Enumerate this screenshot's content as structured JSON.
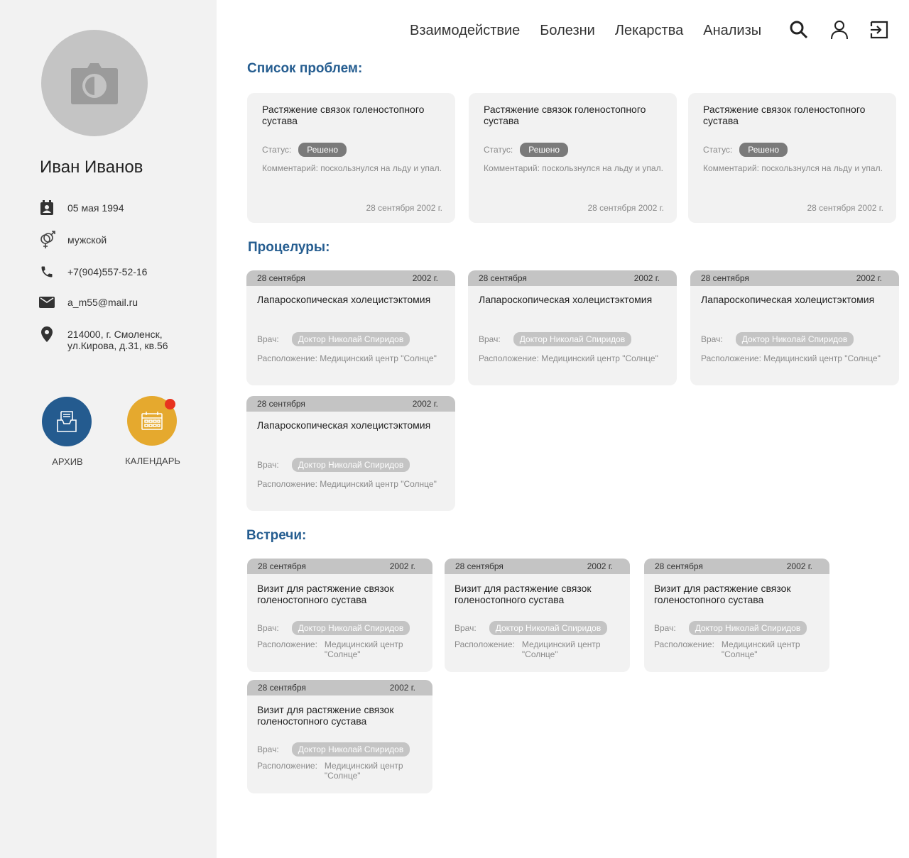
{
  "patient": {
    "name": "Иван Иванов",
    "birthdate": "05 мая 1994",
    "gender": "мужской",
    "phone": "+7(904)557-52-16",
    "email": "a_m55@mail.ru",
    "address_line1": "214000, г. Смоленск,",
    "address_line2": "ул.Кирова, д.31, кв.56"
  },
  "sidebar": {
    "archive_label": "АРХИВ",
    "calendar_label": "КАЛЕНДАРЬ",
    "archive_color": "#245b8f",
    "calendar_color": "#e5a92e"
  },
  "nav": {
    "items": [
      "Взаимодействие",
      "Болезни",
      "Лекарства",
      "Анализы"
    ]
  },
  "sections": {
    "problems_title": "Список проблем:",
    "procedures_title": "Процелуры:",
    "meetings_title": "Встречи:"
  },
  "labels": {
    "status": "Статус:",
    "doctor": "Врач:",
    "location": "Расположение:"
  },
  "problems": [
    {
      "title": "Растяжение связок голеностопного сустава",
      "status": "Решено",
      "comment": "Комментарий: поскользнулся на льду и упал.",
      "date": "28 сентября 2002 г."
    },
    {
      "title": "Растяжение связок голеностопного сустава",
      "status": "Решено",
      "comment": "Комментарий: поскользнулся на льду и упал.",
      "date": "28 сентября 2002 г."
    },
    {
      "title": "Растяжение связок голеностопного сустава",
      "status": "Решено",
      "comment": "Комментарий: поскользнулся на льду и упал.",
      "date": "28 сентября 2002 г."
    }
  ],
  "procedures": [
    {
      "day": "28 сентября",
      "year": "2002 г.",
      "title": "Лапароскопическая холецистэктомия",
      "doctor": "Доктор Николай Спиридов",
      "location": "Расположение: Медицинский центр \"Солнце\""
    },
    {
      "day": "28 сентября",
      "year": "2002 г.",
      "title": "Лапароскопическая холецистэктомия",
      "doctor": "Доктор Николай Спиридов",
      "location": "Расположение: Медицинский центр \"Солнце\""
    },
    {
      "day": "28 сентября",
      "year": "2002 г.",
      "title": "Лапароскопическая холецистэктомия",
      "doctor": "Доктор Николай Спиридов",
      "location": "Расположение: Медицинский центр \"Солнце\""
    },
    {
      "day": "28 сентября",
      "year": "2002 г.",
      "title": "Лапароскопическая холецистэктомия",
      "doctor": "Доктор Николай Спиридов",
      "location": "Расположение: Медицинский центр \"Солнце\""
    }
  ],
  "meetings": [
    {
      "day": "28 сентября",
      "year": "2002 г.",
      "title": "Визит для растяжение связок голеностопного сустава",
      "doctor": "Доктор Николай Спиридов",
      "location_line1": "Медицинский центр",
      "location_line2": "\"Солнце\""
    },
    {
      "day": "28 сентября",
      "year": "2002 г.",
      "title": "Визит для растяжение связок голеностопного сустава",
      "doctor": "Доктор Николай Спиридов",
      "location_line1": "Медицинский центр",
      "location_line2": "\"Солнце\""
    },
    {
      "day": "28 сентября",
      "year": "2002 г.",
      "title": "Визит для растяжение связок голеностопного сустава",
      "doctor": "Доктор Николай Спиридов",
      "location_line1": "Медицинский центр",
      "location_line2": "\"Солнце\""
    },
    {
      "day": "28 сентября",
      "year": "2002 г.",
      "title": "Визит для растяжение связок голеностопного сустава",
      "doctor": "Доктор Николай Спиридов",
      "location_line1": "Медицинский центр",
      "location_line2": "\"Солнце\""
    }
  ]
}
